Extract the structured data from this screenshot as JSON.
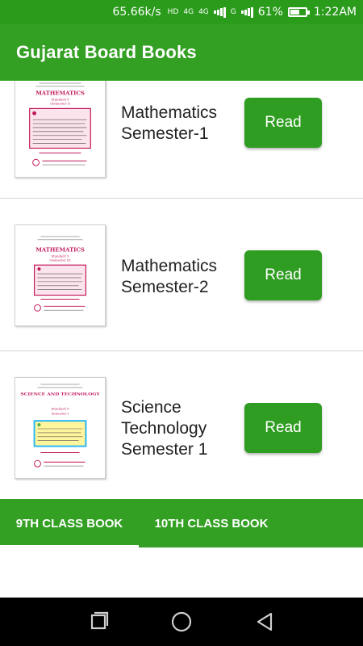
{
  "status_bar": {
    "net_speed": "65.66k/s",
    "hd_label": "HD",
    "network_4g_label": "4G",
    "network_4g_label_2": "4G",
    "network_g_label": "G",
    "battery_percent": "61%",
    "battery_level": 0.61,
    "time": "1:22AM"
  },
  "app_bar": {
    "title": "Gujarat Board Books"
  },
  "books": [
    {
      "title": "Mathematics Semester-1",
      "button": "Read",
      "cover_heading": "MATHEMATICS",
      "cover_sub": "Standard 9",
      "cover_sem": "(Semester I)"
    },
    {
      "title": "Mathematics Semester-2",
      "button": "Read",
      "cover_heading": "MATHEMATICS",
      "cover_sub": "Standard 9",
      "cover_sem": "(Semester II)"
    },
    {
      "title": "Science Technology Semester 1",
      "button": "Read",
      "cover_heading": "SCIENCE AND TECHNOLOGY",
      "cover_sub": "Standard 9",
      "cover_sem": "Semester I"
    }
  ],
  "tabs": [
    {
      "label": "9TH CLASS BOOK",
      "selected": true
    },
    {
      "label": "10TH CLASS BOOK",
      "selected": false
    }
  ],
  "nav": {
    "recents_icon": "recents-icon",
    "home_icon": "home-circle-icon",
    "back_icon": "back-triangle-icon"
  },
  "colors": {
    "primary": "#33a023",
    "primary_dark": "#2a9b1b",
    "button": "#2f9d21"
  }
}
